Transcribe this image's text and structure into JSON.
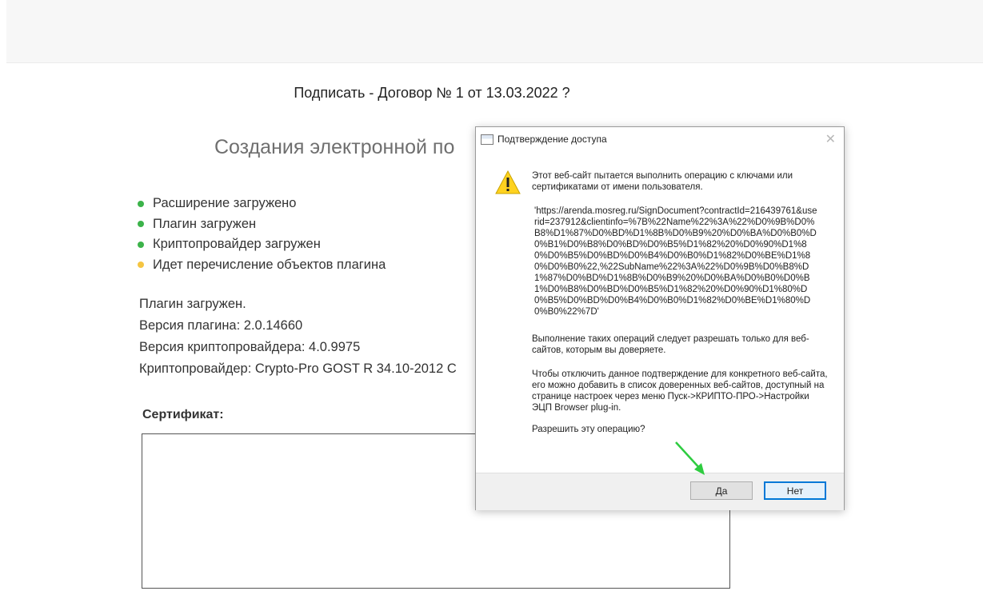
{
  "page": {
    "sign_title": "Подписать - Договор № 1 от 13.03.2022 ?",
    "section_title": "Создания электронной по",
    "status_items": [
      {
        "label": "Расширение загружено",
        "color": "#3cb34a"
      },
      {
        "label": "Плагин загружен",
        "color": "#3cb34a"
      },
      {
        "label": "Криптопровайдер загружен",
        "color": "#3cb34a"
      },
      {
        "label": "Идет перечисление объектов плагина",
        "color": "#f5c542"
      }
    ],
    "info_lines": [
      "Плагин загружен.",
      "Версия плагина: 2.0.14660",
      "Версия криптопровайдера: 4.0.9975",
      "Криптопровайдер: Crypto-Pro GOST R 34.10-2012 C"
    ],
    "certificate_label": "Сертификат:"
  },
  "dialog": {
    "title": "Подтверждение доступа",
    "close_glyph": "✕",
    "message": "Этот веб-сайт пытается выполнить операцию с ключами или сертификатами от имени пользователя.",
    "url": "'https://arenda.mosreg.ru/SignDocument?contractId=216439761&userid=237912&clientinfo=%7B%22Name%22%3A%22%D0%9B%D0%B8%D1%87%D0%BD%D1%8B%D0%B9%20%D0%BA%D0%B0%D0%B1%D0%B8%D0%BD%D0%B5%D1%82%20%D0%90%D1%80%D0%B5%D0%BD%D0%B4%D0%B0%D1%82%D0%BE%D1%80%D0%B0%22,%22SubName%22%3A%22%D0%9B%D0%B8%D1%87%D0%BD%D1%8B%D0%B9%20%D0%BA%D0%B0%D0%B1%D0%B8%D0%BD%D0%B5%D1%82%20%D0%90%D1%80%D0%B5%D0%BD%D0%B4%D0%B0%D1%82%D0%BE%D1%80%D0%B0%22%7D'",
    "trust_note": "Выполнение таких операций следует разрешать только для веб-сайтов, которым вы доверяете.",
    "disable_note": "Чтобы отключить данное подтверждение для конкретного веб-сайта, его можно добавить в список доверенных веб-сайтов, доступный на странице настроек через меню Пуск->КРИПТО-ПРО->Настройки ЭЦП Browser plug-in.",
    "question": "Разрешить эту операцию?",
    "yes_label": "Да",
    "no_label": "Нет",
    "warning_icon": "warning-triangle-icon"
  },
  "colors": {
    "accent_focus": "#0078d7",
    "arrow": "#2ecc40"
  }
}
